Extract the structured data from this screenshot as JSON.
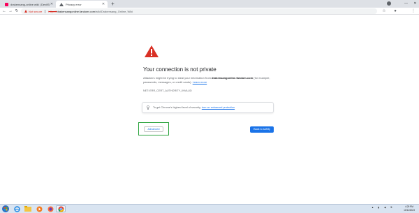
{
  "tabs": [
    {
      "title": "drakensang-online wiki | DevilSlash"
    },
    {
      "title": "Privacy error"
    }
  ],
  "new_tab_symbol": "+",
  "window_controls": {
    "minimize": "—",
    "close": "✕"
  },
  "toolbar": {
    "back": "←",
    "forward": "→",
    "reload": "↻",
    "not_secure_label": "Not secure",
    "url_scheme": "https://",
    "url_host": "drakensangonline.fandom.com",
    "url_path": "/wiki/Drakensang_Online_Wiki",
    "menu": "⋮"
  },
  "interstitial": {
    "title": "Your connection is not private",
    "message_prefix": "Attackers might be trying to steal your information from ",
    "message_host": "drakensangonline.fandom.com",
    "message_suffix": " (for example, passwords, messages, or credit cards).",
    "learn_more": "Learn more",
    "error_code": "NET::ERR_CERT_AUTHORITY_INVALID",
    "enhanced_text": "To get Chrome's highest level of security, ",
    "enhanced_link": "turn on enhanced protection",
    "advanced_button": "Advanced",
    "back_button": "Back to safety"
  },
  "taskbar": {
    "clock_time": "4:29 PM",
    "clock_date": "10/11/2023"
  },
  "colors": {
    "danger": "#d93025",
    "link": "#1a73e8",
    "primary_button": "#1a73e8",
    "highlight": "#2aa33c"
  }
}
